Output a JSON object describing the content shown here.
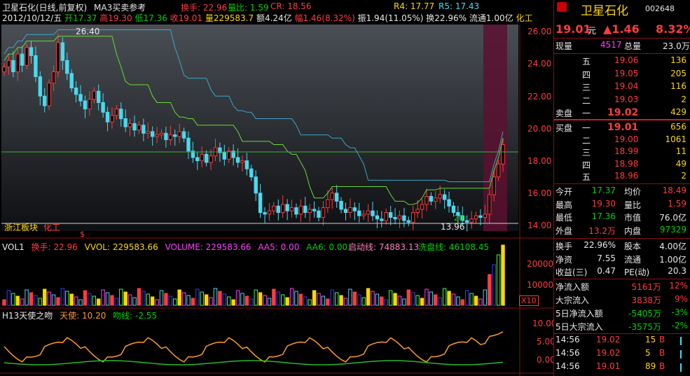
{
  "header": {
    "title": "卫星石化(日线,前复权)",
    "indicator": "MA3买卖参考",
    "date": "2012/10/12/五",
    "open_label": "开",
    "open": "17.37",
    "high_label": "高",
    "high": "19.30",
    "low_label": "低",
    "low": "17.36",
    "close_label": "收",
    "close": "19.01",
    "vol_label": "量",
    "vol": "229583.7",
    "amount_label": "额",
    "amount": "4.24亿",
    "change_label": "幅",
    "change": "1.46(8.32%)",
    "amp_label": "振",
    "amp": "1.94(11.05%)",
    "turnover_label": "换",
    "turnover": "22.96%",
    "float_label": "流通",
    "float": "1.00亿",
    "industry": "化工",
    "overlay_turnover": "换手: 22.96",
    "overlay_volratio": "量比: 1.59",
    "overlay_cr": "CR: 18.56",
    "overlay_r4": "R4: 17.77",
    "overlay_r5": "R5: 17.43"
  },
  "main_chart": {
    "y_ticks": [
      "26.00",
      "24.00",
      "22.00",
      "20.00",
      "18.00",
      "16.00",
      "14.00"
    ],
    "high_marker": "26.40",
    "low_marker": "13.96",
    "small_marker": "20",
    "region_label": "浙江板块",
    "industry_label": "化工",
    "dollar_sign": "$"
  },
  "vol_panel": {
    "title": "VOL1",
    "turnover": "换手: 22.96",
    "vvol": "VVOL: 229583.66",
    "volume": "VOLUME: 229583.66",
    "aa5": "AA5: 0.00",
    "aa6": "AA6: 0.00",
    "start_line": "启动线: 74883.13",
    "wash_line": "洗盘线: 46108.45",
    "y_ticks": [
      "20000",
      "10000"
    ],
    "scale": "X10"
  },
  "h13_panel": {
    "title": "H13天使之吻",
    "angel": "天使: 10.20",
    "kiss": "吻线: -2.55",
    "y_ticks": [
      "10.00",
      "5.00",
      "0.00"
    ]
  },
  "panel": {
    "name": "卫星石化",
    "code": "002648",
    "price": "19.01",
    "unit": "元",
    "change": "▲1.46",
    "change_pct": "8.32%",
    "now_vol_label": "现量",
    "now_vol": "4517",
    "total_vol_label": "总量",
    "total_vol": "23.0万",
    "asks": [
      {
        "level": "五",
        "price": "19.06",
        "vol": "136"
      },
      {
        "level": "四",
        "price": "19.05",
        "vol": "205"
      },
      {
        "level": "三",
        "price": "19.04",
        "vol": "116"
      },
      {
        "level": "二",
        "price": "19.03",
        "vol": "2"
      },
      {
        "level": "一",
        "price": "19.02",
        "vol": "429"
      }
    ],
    "sell_label": "卖盘",
    "buy_label": "买盘",
    "bids": [
      {
        "level": "一",
        "price": "19.01",
        "vol": "656"
      },
      {
        "level": "二",
        "price": "19.00",
        "vol": "1061"
      },
      {
        "level": "三",
        "price": "18.99",
        "vol": "11"
      },
      {
        "level": "四",
        "price": "18.98",
        "vol": "49"
      },
      {
        "level": "五",
        "price": "18.96",
        "vol": "2"
      }
    ],
    "stats": [
      {
        "l1": "今开",
        "v1": "17.37",
        "l2": "均价",
        "v2": "18.49"
      },
      {
        "l1": "最高",
        "v1": "19.30",
        "l2": "量比",
        "v2": "1.59"
      },
      {
        "l1": "最低",
        "v1": "17.36",
        "l2": "市值",
        "v2": "76.0亿"
      },
      {
        "l1": "外盘",
        "v1": "13.2万",
        "l2": "内盘",
        "v2": "97329"
      }
    ],
    "stats2": [
      {
        "l1": "换手",
        "v1": "22.96%",
        "l2": "股本",
        "v2": "4.00亿"
      },
      {
        "l1": "净资",
        "v1": "7.55",
        "l2": "流通",
        "v2": "1.00亿"
      },
      {
        "l1": "收益(三)",
        "v1": "0.47",
        "l2": "PE(动)",
        "v2": "20.3"
      }
    ],
    "flows": [
      {
        "label": "净流入额",
        "value": "5161万",
        "pct": "12%"
      },
      {
        "label": "大宗流入",
        "value": "3838万",
        "pct": "9%"
      },
      {
        "label": "5日净流入额",
        "value": "-5405万",
        "pct": "-3%"
      },
      {
        "label": "5日大宗流入",
        "value": "-3575万",
        "pct": "-2%"
      }
    ],
    "ticks": [
      {
        "time": "14:56",
        "price": "19.02",
        "vol": "15",
        "side": "B"
      },
      {
        "time": "14:56",
        "price": "19.02",
        "vol": "5",
        "side": "B"
      },
      {
        "time": "14:56",
        "price": "19.01",
        "vol": "89",
        "side": "B"
      }
    ]
  },
  "colors": {
    "up": "#ff3c3c",
    "down": "#4ad9f0",
    "bg": "#000000",
    "accent": "#ffd700"
  }
}
